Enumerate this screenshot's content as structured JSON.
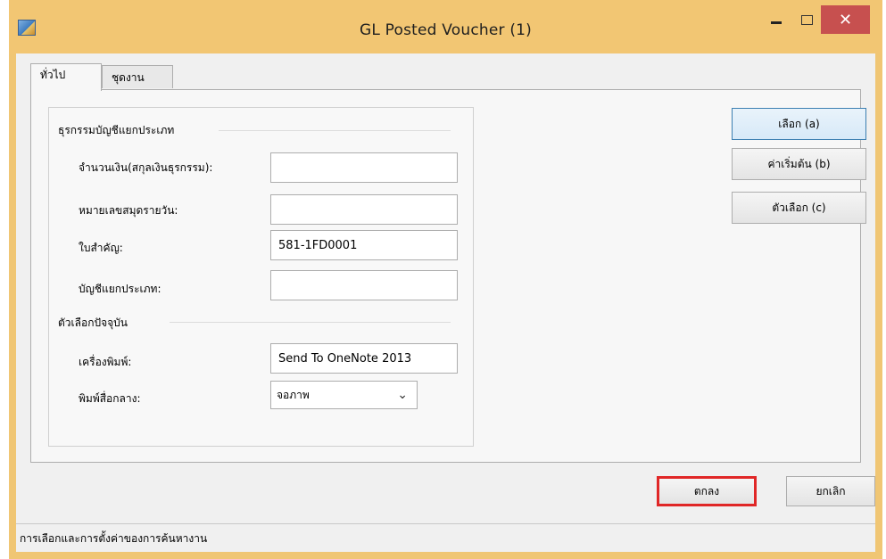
{
  "window": {
    "title": "GL Posted Voucher (1)"
  },
  "caption": {
    "minimize": "–",
    "maximize": "□",
    "close": "✕"
  },
  "tabs": [
    "ทั่วไป",
    "ชุดงาน"
  ],
  "group_general": {
    "legend": "ธุรกรรมบัญชีแยกประเภท",
    "fields": [
      {
        "label": "จำนวนเงิน(สกุลเงินธุรกรรม):",
        "value": ""
      },
      {
        "label": "หมายเลขสมุดรายวัน:",
        "value": ""
      },
      {
        "label": "ใบสำคัญ:",
        "value": "581-1FD0001"
      },
      {
        "label": "บัญชีแยกประเภท:",
        "value": ""
      }
    ]
  },
  "group_options": {
    "legend": "ตัวเลือกปัจจุบัน",
    "printer_label": "เครื่องพิมพ์:",
    "printer_value": "Send To OneNote 2013",
    "print_medium_label": "พิมพ์สื่อกลาง:",
    "print_medium_value": "จอภาพ"
  },
  "side_buttons": [
    "เลือก (a)",
    "ค่าเริ่มต้น (b)",
    "ตัวเลือก (c)"
  ],
  "footer_buttons": {
    "ok": "ตกลง",
    "cancel": "ยกเลิก"
  },
  "status_text": "การเลือกและการตั้งค่าของการค้นหางาน"
}
